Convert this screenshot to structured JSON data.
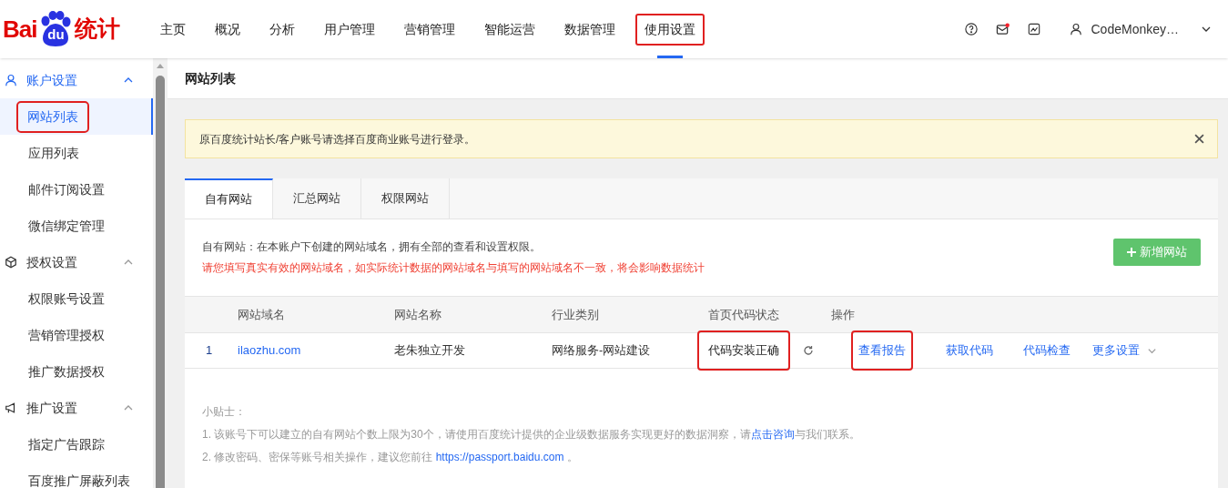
{
  "header": {
    "logo": {
      "left": "Bai",
      "paw": "du",
      "right": "统计"
    },
    "nav": [
      {
        "label": "主页",
        "selected": false,
        "highlighted": false
      },
      {
        "label": "概况",
        "selected": false,
        "highlighted": false
      },
      {
        "label": "分析",
        "selected": false,
        "highlighted": false
      },
      {
        "label": "用户管理",
        "selected": false,
        "highlighted": false
      },
      {
        "label": "营销管理",
        "selected": false,
        "highlighted": false
      },
      {
        "label": "智能运营",
        "selected": false,
        "highlighted": false
      },
      {
        "label": "数据管理",
        "selected": false,
        "highlighted": false
      },
      {
        "label": "使用设置",
        "selected": true,
        "highlighted": true
      }
    ],
    "mail_unread": true,
    "user": "CodeMonkey…"
  },
  "sidebar": {
    "groups": [
      {
        "label": "账户设置",
        "active": true,
        "expanded": true,
        "items": [
          {
            "label": "网站列表",
            "selected": true,
            "highlighted": true
          },
          {
            "label": "应用列表",
            "selected": false,
            "highlighted": false
          },
          {
            "label": "邮件订阅设置",
            "selected": false,
            "highlighted": false
          },
          {
            "label": "微信绑定管理",
            "selected": false,
            "highlighted": false
          }
        ]
      },
      {
        "label": "授权设置",
        "active": false,
        "expanded": true,
        "items": [
          {
            "label": "权限账号设置",
            "selected": false,
            "highlighted": false
          },
          {
            "label": "营销管理授权",
            "selected": false,
            "highlighted": false
          },
          {
            "label": "推广数据授权",
            "selected": false,
            "highlighted": false
          }
        ]
      },
      {
        "label": "推广设置",
        "active": false,
        "expanded": true,
        "items": [
          {
            "label": "指定广告跟踪",
            "selected": false,
            "highlighted": false
          },
          {
            "label": "百度推广屏蔽列表",
            "selected": false,
            "highlighted": false
          }
        ]
      }
    ]
  },
  "page_title": "网站列表",
  "notice": "原百度统计站长/客户账号请选择百度商业账号进行登录。",
  "tabs": [
    {
      "label": "自有网站",
      "selected": true
    },
    {
      "label": "汇总网站",
      "selected": false
    },
    {
      "label": "权限网站",
      "selected": false
    }
  ],
  "description": "自有网站：在本账户下创建的网站域名，拥有全部的查看和设置权限。",
  "warning": "请您填写真实有效的网站域名，如实际统计数据的网站域名与填写的网站域名不一致，将会影响数据统计",
  "add_button": "新增网站",
  "table": {
    "columns": [
      "网站域名",
      "网站名称",
      "行业类别",
      "首页代码状态",
      "操作"
    ],
    "rows": [
      {
        "index": "1",
        "domain": "ilaozhu.com",
        "name": "老朱独立开发",
        "industry": "网络服务-网站建设",
        "status": {
          "text": "代码安装正确",
          "highlighted": true
        },
        "actions": [
          {
            "label": "查看报告",
            "highlighted": true,
            "dropdown": false
          },
          {
            "label": "获取代码",
            "highlighted": false,
            "dropdown": false
          },
          {
            "label": "代码检查",
            "highlighted": false,
            "dropdown": false
          },
          {
            "label": "更多设置",
            "highlighted": false,
            "dropdown": true
          }
        ]
      }
    ]
  },
  "tips": {
    "title": "小贴士：",
    "lines": [
      {
        "before": "1. 该账号下可以建立的自有网站个数上限为30个，请使用百度统计提供的企业级数据服务实现更好的数据洞察，请",
        "link": "点击咨询",
        "after": "与我们联系。"
      },
      {
        "before": "2. 修改密码、密保等账号相关操作，建议您前往 ",
        "link": "https://passport.baidu.com",
        "after": " 。"
      }
    ]
  }
}
